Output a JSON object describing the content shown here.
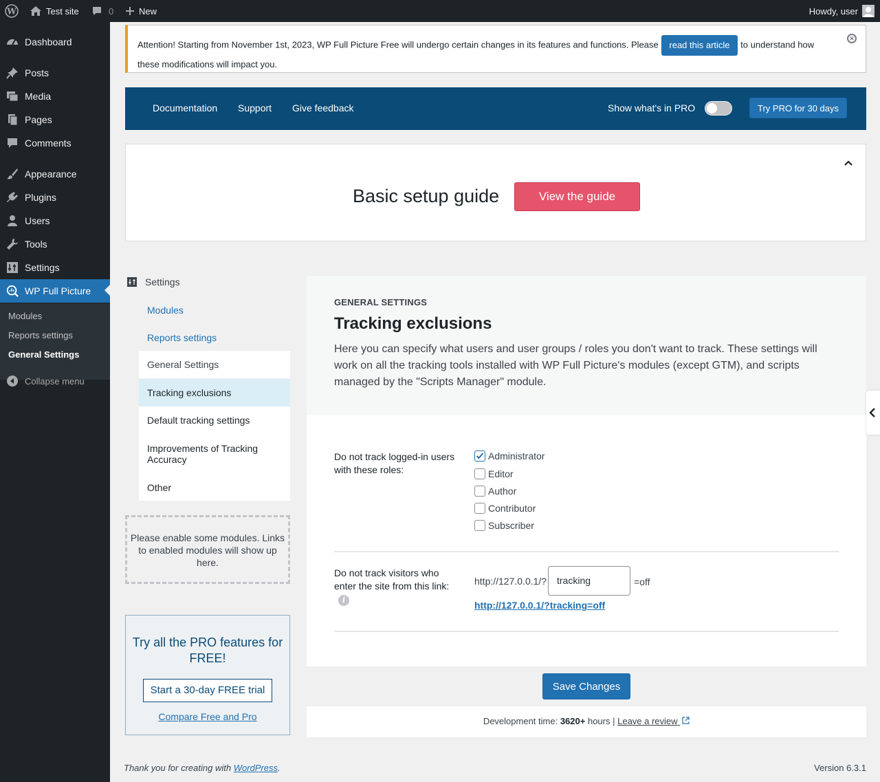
{
  "adminbar": {
    "site_name": "Test site",
    "comments_count": "0",
    "new_label": "New",
    "howdy": "Howdy, user"
  },
  "sidebar": {
    "items": [
      {
        "label": "Dashboard",
        "icon": "dashboard-icon"
      },
      {
        "label": "Posts",
        "icon": "pin-icon"
      },
      {
        "label": "Media",
        "icon": "media-icon"
      },
      {
        "label": "Pages",
        "icon": "pages-icon"
      },
      {
        "label": "Comments",
        "icon": "comments-icon"
      },
      {
        "label": "Appearance",
        "icon": "brush-icon"
      },
      {
        "label": "Plugins",
        "icon": "plugin-icon"
      },
      {
        "label": "Users",
        "icon": "user-icon"
      },
      {
        "label": "Tools",
        "icon": "wrench-icon"
      },
      {
        "label": "Settings",
        "icon": "settings-icon"
      },
      {
        "label": "WP Full Picture",
        "icon": "wpfp-icon"
      }
    ],
    "submenu": [
      "Modules",
      "Reports settings",
      "General Settings"
    ],
    "collapse": "Collapse menu"
  },
  "notice": {
    "text_before": "Attention! Starting from November 1st, 2023, WP Full Picture Free will undergo certain changes in its features and functions. Please",
    "button": "read this article",
    "text_after": "to understand how these modifications will impact you."
  },
  "topnav": {
    "links": [
      "Documentation",
      "Support",
      "Give feedback"
    ],
    "toggle_label": "Show what's in PRO",
    "try_pro": "Try PRO for 30 days"
  },
  "guide": {
    "title": "Basic setup guide",
    "button": "View the guide"
  },
  "leftnav": {
    "heading": "Settings",
    "links": [
      "Modules",
      "Reports settings"
    ],
    "items": [
      "General Settings",
      "Tracking exclusions",
      "Default tracking settings",
      "Improvements of Tracking Accuracy",
      "Other"
    ],
    "modules_note": "Please enable some modules. Links to enabled modules will show up here."
  },
  "pro_box": {
    "title": "Try all the PRO features for FREE!",
    "trial_button": "Start a 30-day FREE trial",
    "compare_link": "Compare Free and Pro"
  },
  "panel": {
    "eyebrow": "GENERAL SETTINGS",
    "title": "Tracking exclusions",
    "description": "Here you can specify what users and user groups / roles you don't want to track. These settings will work on all the tracking tools installed with WP Full Picture's modules (except GTM), and scripts managed by the \"Scripts Manager\" module.",
    "roles_label": "Do not track logged-in users with these roles:",
    "roles": [
      {
        "label": "Administrator",
        "checked": true
      },
      {
        "label": "Editor",
        "checked": false
      },
      {
        "label": "Author",
        "checked": false
      },
      {
        "label": "Contributor",
        "checked": false
      },
      {
        "label": "Subscriber",
        "checked": false
      }
    ],
    "link_label": "Do not track visitors who enter the site from this link:",
    "url_prefix": "http://127.0.0.1/?",
    "url_param": "tracking",
    "url_suffix": "=off",
    "url_full": "http://127.0.0.1/?tracking=off",
    "save_button": "Save Changes",
    "dev_time_prefix": "Development time:",
    "dev_time_value": "3620+",
    "dev_time_suffix": "hours |",
    "review_link": "Leave a review"
  },
  "footer": {
    "thanks_prefix": "Thank you for creating with",
    "wordpress": "WordPress",
    "thanks_suffix": ".",
    "version": "Version 6.3.1"
  },
  "colors": {
    "admin_dark": "#1d2327",
    "wp_blue": "#2271b1",
    "plugin_nav": "#0a4b78",
    "guide_button": "#e5546a",
    "notice_border": "#dba617"
  }
}
